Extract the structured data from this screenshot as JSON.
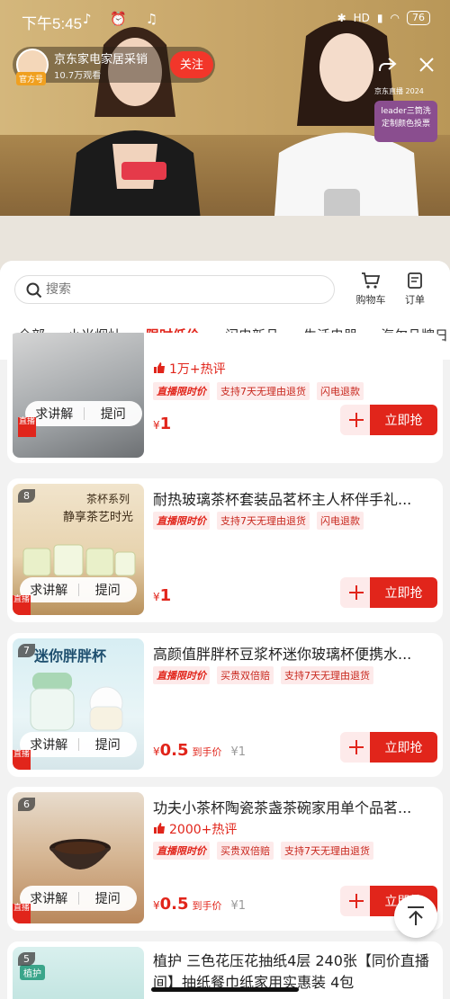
{
  "status_bar": {
    "time": "下午5:45",
    "battery": "76",
    "network": "HD"
  },
  "host": {
    "badge": "官方号",
    "name": "京东家电家居采销",
    "views": "10.7万观看",
    "follow_label": "关注"
  },
  "promo": {
    "top_text": "京东直播 2024",
    "text": "leader三筒洗 定制颜色投票"
  },
  "search": {
    "placeholder": "搜索"
  },
  "actions": {
    "cart": "购物车",
    "orders": "订单"
  },
  "tabs": [
    {
      "label": "全部"
    },
    {
      "label": "小米烟灶"
    },
    {
      "label": "限时低价"
    },
    {
      "label": "闪电新品"
    },
    {
      "label": "生活电器"
    },
    {
      "label": "海尔品牌日"
    }
  ],
  "common": {
    "ask_label": "求讲解",
    "question_label": "提问",
    "buy_label": "立即抢",
    "corner_tag": "直播"
  },
  "products": [
    {
      "rank": "",
      "title": "",
      "hot": "1万+热评",
      "tags": [
        "直播限时价",
        "支持7天无理由退货",
        "闪电退款"
      ],
      "price_symbol": "¥",
      "price": "1",
      "hand_price_label": "",
      "orig": ""
    },
    {
      "rank": "8",
      "title": "耐热玻璃茶杯套装品茗杯主人杯伴手礼...",
      "hot": "",
      "tags": [
        "直播限时价",
        "支持7天无理由退货",
        "闪电退款"
      ],
      "price_symbol": "¥",
      "price": "1",
      "hand_price_label": "",
      "orig": ""
    },
    {
      "rank": "7",
      "title": "高颜值胖胖杯豆浆杯迷你玻璃杯便携水...",
      "hot": "",
      "tags": [
        "直播限时价",
        "买贵双倍赔",
        "支持7天无理由退货"
      ],
      "price_symbol": "¥",
      "price": "0.5",
      "hand_price_label": "到手价",
      "orig": "¥1"
    },
    {
      "rank": "6",
      "title": "功夫小茶杯陶瓷茶盏茶碗家用单个品茗...",
      "hot": "2000+热评",
      "tags": [
        "直播限时价",
        "买贵双倍赔",
        "支持7天无理由退货"
      ],
      "price_symbol": "¥",
      "price": "0.5",
      "hand_price_label": "到手价",
      "orig": "¥1"
    },
    {
      "rank": "5",
      "title": "植护 三色花压花抽纸4层 240张【同价直播间】抽纸餐巾纸家用实惠装 4包"
    }
  ],
  "thumb_texts": {
    "p8_line1": "茶杯系列",
    "p8_line2": "静享茶艺时光",
    "p7_line1": "迷你胖胖杯",
    "p5_tag": "植护"
  },
  "colors": {
    "accent": "#e1251b",
    "follow": "#f2362a"
  }
}
